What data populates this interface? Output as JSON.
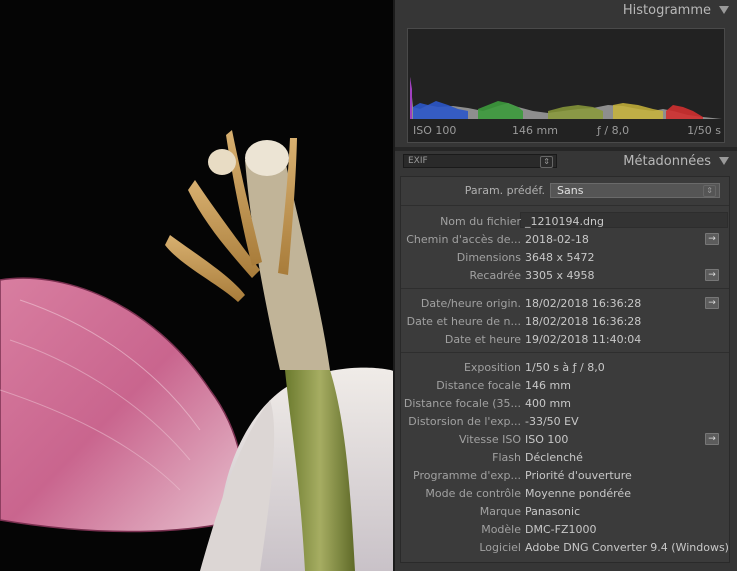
{
  "histogram": {
    "title": "Histogramme",
    "iso": "ISO 100",
    "focal": "146 mm",
    "aperture": "ƒ / 8,0",
    "shutter": "1/50 s"
  },
  "metadata": {
    "title": "Métadonnées",
    "set_select": "EXIF",
    "preset_label": "Param. prédéf.",
    "preset_value": "Sans",
    "groups": [
      [
        {
          "label": "Nom du fichier",
          "value": "_1210194.dng",
          "arrow": false
        },
        {
          "label": "Chemin d'accès de...",
          "value": "2018-02-18",
          "arrow": true
        },
        {
          "label": "Dimensions",
          "value": "3648 x 5472",
          "arrow": false
        },
        {
          "label": "Recadrée",
          "value": "3305 x 4958",
          "arrow": true
        }
      ],
      [
        {
          "label": "Date/heure origin.",
          "value": "18/02/2018 16:36:28",
          "arrow": true
        },
        {
          "label": "Date et heure de n...",
          "value": "18/02/2018 16:36:28",
          "arrow": false
        },
        {
          "label": "Date et heure",
          "value": "19/02/2018 11:40:04",
          "arrow": false
        }
      ],
      [
        {
          "label": "Exposition",
          "value": "1/50 s à ƒ / 8,0",
          "arrow": false
        },
        {
          "label": "Distance focale",
          "value": "146 mm",
          "arrow": false
        },
        {
          "label": "Distance focale (35...",
          "value": "400 mm",
          "arrow": false
        },
        {
          "label": "Distorsion de l'exp...",
          "value": "-33/50 EV",
          "arrow": false
        },
        {
          "label": "Vitesse ISO",
          "value": "ISO 100",
          "arrow": true
        },
        {
          "label": "Flash",
          "value": "Déclenché",
          "arrow": false
        },
        {
          "label": "Programme d'exp...",
          "value": "Priorité d'ouverture",
          "arrow": false
        },
        {
          "label": "Mode de contrôle",
          "value": "Moyenne pondérée",
          "arrow": false
        },
        {
          "label": "Marque",
          "value": "Panasonic",
          "arrow": false
        },
        {
          "label": "Modèle",
          "value": "DMC-FZ1000",
          "arrow": false
        },
        {
          "label": "Logiciel",
          "value": "Adobe DNG Converter 9.4 (Windows)",
          "arrow": false
        }
      ]
    ]
  },
  "icons": {
    "arrow": "→",
    "stepper": "⇕"
  }
}
